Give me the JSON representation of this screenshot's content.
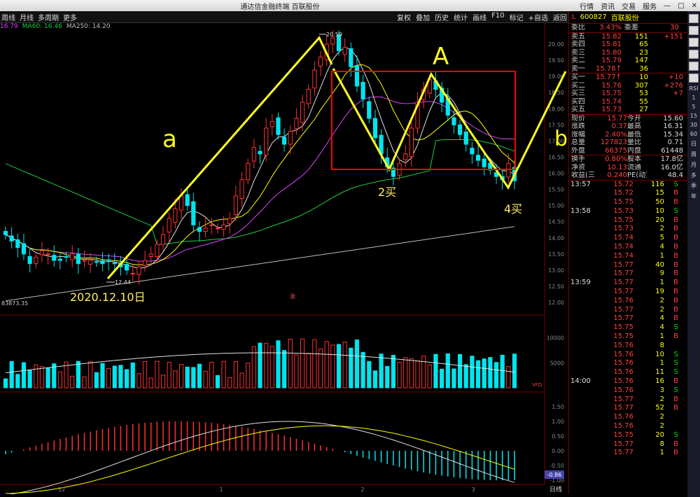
{
  "window": {
    "title": "通达信金融终端 百联股份",
    "buttons": [
      "行情",
      "资讯",
      "交易",
      "服务"
    ]
  },
  "toolbar": {
    "left": [
      "周线",
      "月线",
      "多周期",
      "更多"
    ],
    "right": [
      "复权",
      "叠加",
      "历史",
      "统计",
      "画线",
      "F10",
      "标记",
      "+自选",
      "返回"
    ]
  },
  "ma_legend": [
    {
      "text": "16.79",
      "color": "#dd44ff"
    },
    {
      "text": "MA60: 16.46",
      "color": "#22cc44"
    },
    {
      "text": "MA250: 14.20",
      "color": "#bbbbbb"
    }
  ],
  "chart": {
    "price_axis": [
      "20.00",
      "19.50",
      "19.00",
      "18.50",
      "18.00",
      "17.50",
      "17.00",
      "16.50",
      "16.00",
      "15.50",
      "15.00",
      "14.50",
      "14.00",
      "13.50",
      "13.00",
      "12.50",
      "12.00"
    ],
    "vol_axis": [
      "10000",
      "5000"
    ],
    "macd_axis": [
      "1.50",
      "1.00",
      "0.50",
      "0.00",
      "-0.50",
      "-1.00"
    ],
    "high_label": "20.59",
    "low_label": "12.44",
    "vol_label": "83873.35",
    "macd_value": "-0.86",
    "vol_tag": "VFD",
    "mark": "涨",
    "annotations": {
      "a": "a",
      "A": "A",
      "b": "b",
      "buy2": "2买",
      "buy4": "4买",
      "date": "2020.12.10日"
    },
    "x_labels": [
      "12",
      "1",
      "2",
      "3"
    ],
    "bottom_tag": "日线"
  },
  "panel": {
    "code": "600827",
    "name": "百联股份",
    "prefix": "L",
    "ratio": {
      "label": "委比",
      "value": "3.43%",
      "label2": "委差",
      "value2": "30"
    },
    "asks": [
      {
        "label": "卖五",
        "price": "15.82",
        "vol": "151",
        "chg": "+151"
      },
      {
        "label": "卖四",
        "price": "15.81",
        "vol": "65",
        "chg": ""
      },
      {
        "label": "卖三",
        "price": "15.80",
        "vol": "23",
        "chg": ""
      },
      {
        "label": "卖二",
        "price": "15.79",
        "vol": "147",
        "chg": ""
      },
      {
        "label": "卖一",
        "price": "15.78↑",
        "vol": "36",
        "chg": ""
      }
    ],
    "bids": [
      {
        "label": "买一",
        "price": "15.77↑",
        "vol": "10",
        "chg": "+10"
      },
      {
        "label": "买二",
        "price": "15.76",
        "vol": "307",
        "chg": "+276"
      },
      {
        "label": "买三",
        "price": "15.75",
        "vol": "53",
        "chg": "+7"
      },
      {
        "label": "买四",
        "price": "15.74",
        "vol": "55",
        "chg": ""
      },
      {
        "label": "买五",
        "price": "15.73",
        "vol": "27",
        "chg": ""
      }
    ],
    "stats": [
      {
        "l1": "现价",
        "v1": "15.77",
        "l2": "今开",
        "v2": "15.60"
      },
      {
        "l1": "涨跌",
        "v1": "0.37",
        "l2": "最高",
        "v2": "16.31"
      },
      {
        "l1": "涨幅",
        "v1": "2.40%",
        "l2": "最低",
        "v2": "15.34"
      },
      {
        "l1": "总量",
        "v1": "127823",
        "l2": "量比",
        "v2": "0.71"
      },
      {
        "l1": "外盘",
        "v1": "66375",
        "l2": "内盘",
        "v2": "61448"
      }
    ],
    "stats2": [
      {
        "l1": "换手",
        "v1": "0.80%",
        "l2": "股本",
        "v2": "17.8亿"
      },
      {
        "l1": "净资",
        "v1": "10.13",
        "l2": "流通",
        "v2": "16.0亿"
      },
      {
        "l1": "收益(三)",
        "v1": "0.240",
        "l2": "PE(动)",
        "v2": "48.4"
      }
    ],
    "ticks": [
      {
        "t": "13:57",
        "p": "15.72",
        "v": "116",
        "s": "S"
      },
      {
        "t": "",
        "p": "15.72",
        "v": "15",
        "s": "B"
      },
      {
        "t": "",
        "p": "15.75",
        "v": "50",
        "s": "B"
      },
      {
        "t": "13:58",
        "p": "15.73",
        "v": "10",
        "s": "S"
      },
      {
        "t": "",
        "p": "15.75",
        "v": "20",
        "s": "B"
      },
      {
        "t": "",
        "p": "15.73",
        "v": "2",
        "s": "B"
      },
      {
        "t": "",
        "p": "15.74",
        "v": "5",
        "s": "B"
      },
      {
        "t": "",
        "p": "15.74",
        "v": "4",
        "s": "B"
      },
      {
        "t": "",
        "p": "15.74",
        "v": "1",
        "s": "B"
      },
      {
        "t": "",
        "p": "15.77",
        "v": "40",
        "s": "B"
      },
      {
        "t": "",
        "p": "15.77",
        "v": "9",
        "s": "B"
      },
      {
        "t": "13:59",
        "p": "15.77",
        "v": "1",
        "s": "B"
      },
      {
        "t": "",
        "p": "15.77",
        "v": "19",
        "s": "B"
      },
      {
        "t": "",
        "p": "15.76",
        "v": "2",
        "s": "B"
      },
      {
        "t": "",
        "p": "15.77",
        "v": "2",
        "s": "B"
      },
      {
        "t": "",
        "p": "15.77",
        "v": "4",
        "s": "B"
      },
      {
        "t": "",
        "p": "15.75",
        "v": "4",
        "s": "S"
      },
      {
        "t": "",
        "p": "15.75",
        "v": "1",
        "s": "B"
      },
      {
        "t": "",
        "p": "15.76",
        "v": "8",
        "s": ""
      },
      {
        "t": "",
        "p": "15.76",
        "v": "10",
        "s": "S"
      },
      {
        "t": "",
        "p": "15.76",
        "v": "1",
        "s": "S"
      },
      {
        "t": "",
        "p": "15.76",
        "v": "11",
        "s": "S"
      },
      {
        "t": "14:00",
        "p": "15.76",
        "v": "16",
        "s": "B"
      },
      {
        "t": "",
        "p": "15.76",
        "v": "3",
        "s": "S"
      },
      {
        "t": "",
        "p": "15.77",
        "v": "2",
        "s": "B"
      },
      {
        "t": "",
        "p": "15.77",
        "v": "52",
        "s": "B"
      },
      {
        "t": "",
        "p": "15.76",
        "v": "2",
        "s": ""
      },
      {
        "t": "",
        "p": "15.76",
        "v": "2",
        "s": ""
      },
      {
        "t": "",
        "p": "15.75",
        "v": "20",
        "s": "S"
      },
      {
        "t": "",
        "p": "15.77",
        "v": "8",
        "s": "B"
      },
      {
        "t": "",
        "p": "15.77",
        "v": "1",
        "s": "B"
      }
    ]
  },
  "sidebar": [
    "RSI",
    "1",
    "5",
    "15",
    "30",
    "60",
    "日",
    "周",
    "月",
    "多",
    "季",
    "年"
  ],
  "colors": {
    "up": "#ff3030",
    "down": "#00e5ee",
    "ma5": "#e0e0e0",
    "ma10": "#ffff00",
    "ma20": "#dd44ff",
    "ma60": "#22cc44",
    "ma250": "#bbbbbb",
    "draw": "#ffff22",
    "box": "#ff0000"
  }
}
